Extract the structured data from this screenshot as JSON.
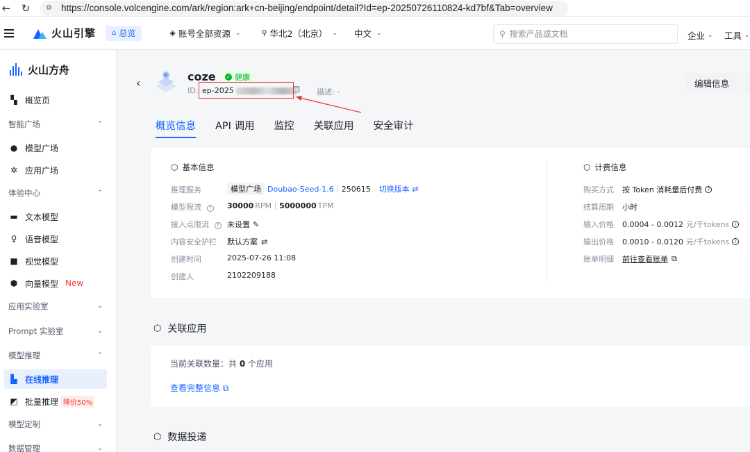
{
  "browser": {
    "url": "https://console.volcengine.com/ark/region:ark+cn-beijing/endpoint/detail?Id=ep-20250726110824-kd7bf&Tab=overview"
  },
  "header": {
    "brand": "火山引擎",
    "home": "总览",
    "resources": "账号全部资源",
    "region": "华北2（北京）",
    "language": "中文",
    "search_placeholder": "搜索产品或文档",
    "enterprise": "企业",
    "tools": "工具"
  },
  "sidebar": {
    "title": "火山方舟",
    "items": [
      {
        "label": "概览页",
        "icon": "dashboard-icon"
      },
      {
        "label": "智能广场",
        "type": "group"
      },
      {
        "label": "模型广场",
        "icon": "brain-icon"
      },
      {
        "label": "应用广场",
        "icon": "atom-icon"
      },
      {
        "label": "体验中心",
        "type": "group"
      },
      {
        "label": "文本模型",
        "icon": "text-icon"
      },
      {
        "label": "语音模型",
        "icon": "mic-icon"
      },
      {
        "label": "视觉模型",
        "icon": "image-icon"
      },
      {
        "label": "向量模型",
        "icon": "vector-icon",
        "badge": "New"
      },
      {
        "label": "应用实验室",
        "type": "group"
      },
      {
        "label": "Prompt 实验室",
        "type": "group"
      },
      {
        "label": "模型推理",
        "type": "group"
      },
      {
        "label": "在线推理",
        "icon": "chart-icon",
        "active": true
      },
      {
        "label": "批量推理",
        "icon": "batch-icon",
        "badge": "降价50%"
      },
      {
        "label": "模型定制",
        "type": "group"
      },
      {
        "label": "数据管理",
        "type": "group"
      }
    ]
  },
  "endpoint": {
    "name": "coze",
    "status": "健康",
    "id_label": "ID:",
    "id_prefix": "ep-2025",
    "desc_label": "描述:",
    "desc_value": "-",
    "edit_button": "编辑信息"
  },
  "tabs": [
    "概览信息",
    "API 调用",
    "监控",
    "关联应用",
    "安全审计"
  ],
  "basic_info": {
    "title": "基本信息",
    "rows": {
      "service_label": "推理服务",
      "service_chip": "模型广场",
      "service_model": "Doubao-Seed-1.6",
      "service_version": "250615",
      "service_switch": "切换版本",
      "limit_label": "模型限流",
      "limit_rpm": "30000",
      "limit_rpm_unit": "RPM",
      "limit_tpm": "5000000",
      "limit_tpm_unit": "TPM",
      "access_label": "接入点限流",
      "access_value": "未设置",
      "safety_label": "内容安全护栏",
      "safety_value": "默认方案",
      "created_label": "创建时间",
      "created_value": "2025-07-26 11:08",
      "creator_label": "创建人",
      "creator_value": "2102209188"
    }
  },
  "billing_info": {
    "title": "计费信息",
    "purchase_label": "购买方式",
    "purchase_value": "按 Token 消耗量后付费",
    "cycle_label": "结算周期",
    "cycle_value": "小时",
    "input_label": "输入价格",
    "input_value": "0.0004 - 0.0012",
    "input_unit": "元/千tokens",
    "output_label": "输出价格",
    "output_value": "0.0010 - 0.0120",
    "output_unit": "元/千tokens",
    "bill_label": "账单明细",
    "bill_link": "前往查看账单"
  },
  "related_apps": {
    "title": "关联应用",
    "count_prefix": "当前关联数量：共",
    "count": "0",
    "count_suffix": "个应用",
    "link": "查看完整信息"
  },
  "data_delivery": {
    "title": "数据投递"
  }
}
